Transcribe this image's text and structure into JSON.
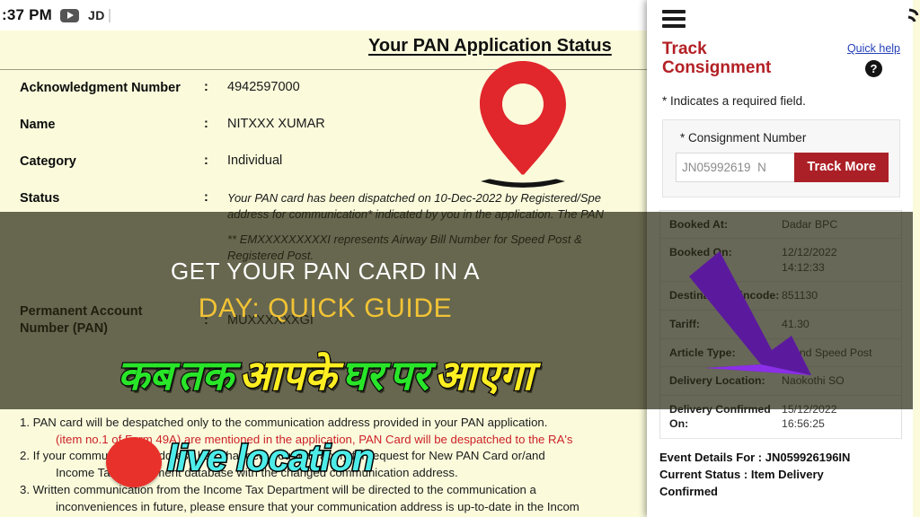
{
  "status_bar": {
    "clock": ":37 PM",
    "youtube_icon": "youtube-icon",
    "account_initials": "JD"
  },
  "pan_document": {
    "title": "Your PAN Application Status",
    "fields": [
      {
        "label": "Acknowledgment Number",
        "separator": ":",
        "value": "4942597000"
      },
      {
        "label": "Name",
        "separator": ":",
        "value": "NITXXX XUMAR"
      },
      {
        "label": "Category",
        "separator": ":",
        "value": "Individual"
      }
    ],
    "status": {
      "label": "Status",
      "separator": ":",
      "paragraph_1": "Your PAN card has been dispatched on 10-Dec-2022 by Registered/Spe",
      "paragraph_2": "address for communication* indicated by you in the application. The PAN",
      "paragraph_3": "**  EMXXXXXXXXXI  represents  Airway  Bill  Number  for  Speed  Post  &",
      "paragraph_4": "Registered Post."
    },
    "pan": {
      "label_line_1": "Permanent Account",
      "label_line_2": "Number (PAN)",
      "separator": ":",
      "value": "MUXXXXXXGI"
    },
    "pin_icon": "map-pin-icon",
    "notes": [
      "1. PAN card will be despatched only to the communication address provided in your PAN application.",
      "(item no.1 of Form 49A) are mentioned in the application, PAN Card will be despatched to the RA's",
      "2. If your communication address has changed, you may apply for request for New PAN Card or/and",
      "Income Tax Department database with the changed communication address.",
      "3. Written communication from the Income Tax Department will be directed to the communication a",
      "inconveniences in future, please ensure that your communication address is up-to-date in the Incom"
    ],
    "notes_red_index": 1
  },
  "overlay": {
    "title_line_1": "GET YOUR PAN CARD IN A",
    "title_line_2": "DAY: QUICK GUIDE",
    "title_line_1_color": "#ffffff",
    "title_line_2_color": "#f2c335",
    "band_color": "#282812",
    "hindi_words": [
      {
        "text": "कब",
        "color": "green"
      },
      {
        "text": "तक",
        "color": "green"
      },
      {
        "text": "आपके",
        "color": "yellow"
      },
      {
        "text": "घर",
        "color": "green"
      },
      {
        "text": "पर",
        "color": "green"
      },
      {
        "text": "आएगा",
        "color": "yellow"
      }
    ],
    "hindi_green": "#29e529",
    "hindi_yellow": "#ffee22",
    "callout_text": "live location",
    "callout_color": "#4dece9",
    "red_dot": "red-dot-marker",
    "arrow_icon": "purple-down-arrow-icon",
    "arrow_color": "#5b1a9e"
  },
  "track_panel": {
    "menu_icon": "hamburger-menu-icon",
    "heading_line_1": "Track",
    "heading_line_2": "Consignment",
    "heading_color": "#b32025",
    "quick_help_label": "Quick help",
    "quick_help_icon": "question-mark-icon",
    "required_note": "* Indicates a required field.",
    "consignment_label": "* Consignment Number",
    "consignment_value": "JN05992619  N",
    "track_button": "Track More",
    "track_button_color": "#ab2026",
    "details": [
      {
        "key": "Booked At:",
        "value": "Dadar BPC"
      },
      {
        "key": "Booked On:",
        "value": "12/12/2022\n14:12:33"
      },
      {
        "key": "Destination Pincode:",
        "value": "851130"
      },
      {
        "key": "Tariff:",
        "value": "41.30"
      },
      {
        "key": "Article Type:",
        "value": "Inland Speed Post"
      },
      {
        "key": "Delivery Location:",
        "value": "Naokothi SO"
      },
      {
        "key": "Delivery Confirmed On:",
        "value": "15/12/2022\n16:56:25"
      }
    ],
    "event_details_line_1": "Event Details For : JN059926196IN",
    "event_details_line_2": "Current Status : Item Delivery",
    "event_details_line_3": "Confirmed"
  }
}
